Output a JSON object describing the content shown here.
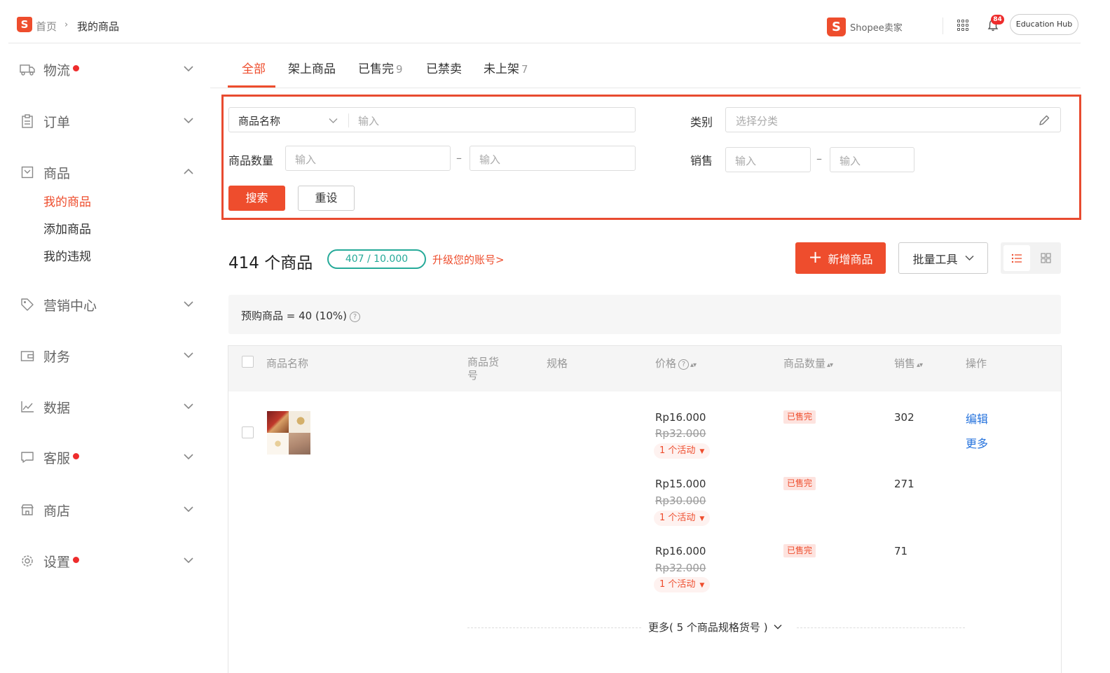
{
  "breadcrumb": {
    "home": "首页",
    "sep": "›",
    "current": "我的商品"
  },
  "header": {
    "logo_letter": "S",
    "brand_text": "Shopee卖家",
    "notification_count": "84",
    "education_hub": "Education Hub"
  },
  "sidebar": {
    "items": [
      {
        "label": "物流",
        "icon": "truck-icon",
        "dot": true
      },
      {
        "label": "订单",
        "icon": "clipboard-icon",
        "dot": false
      },
      {
        "label": "商品",
        "icon": "box-icon",
        "dot": false,
        "expanded": true
      },
      {
        "label": "营销中心",
        "icon": "tag-icon",
        "dot": false
      },
      {
        "label": "财务",
        "icon": "wallet-icon",
        "dot": false
      },
      {
        "label": "数据",
        "icon": "chart-icon",
        "dot": false
      },
      {
        "label": "客服",
        "icon": "chat-icon",
        "dot": true
      },
      {
        "label": "商店",
        "icon": "shop-icon",
        "dot": false
      },
      {
        "label": "设置",
        "icon": "gear-icon",
        "dot": true
      }
    ],
    "sub_items": [
      {
        "label": "我的商品",
        "active": true
      },
      {
        "label": "添加商品",
        "active": false
      },
      {
        "label": "我的违规",
        "active": false
      }
    ]
  },
  "tabs": [
    {
      "label": "全部",
      "count": ""
    },
    {
      "label": "架上商品",
      "count": ""
    },
    {
      "label": "已售完",
      "count": "9"
    },
    {
      "label": "已禁卖",
      "count": ""
    },
    {
      "label": "未上架",
      "count": "7"
    }
  ],
  "filters": {
    "name_select": "商品名称",
    "name_placeholder": "输入",
    "category_label": "类别",
    "category_placeholder": "选择分类",
    "stock_label": "商品数量",
    "stock_min_placeholder": "输入",
    "stock_max_placeholder": "输入",
    "sales_label": "销售",
    "sales_min_placeholder": "输入",
    "sales_max_placeholder": "输入",
    "range_sep": "–",
    "search_button": "搜索",
    "reset_button": "重设"
  },
  "summary": {
    "count_num": "414",
    "count_unit": "个商品",
    "quota": "407 / 10.000",
    "upgrade_link": "升级您的账号>",
    "add_button": "新增商品",
    "add_plus": "+",
    "bulk_button": "批量工具"
  },
  "notice": {
    "text": "预购商品 = 40 (10%)",
    "help": "?"
  },
  "table": {
    "headers": {
      "name": "商品名称",
      "sku_line1": "商品货",
      "sku_line2": "号",
      "variation": "规格",
      "price": "价格",
      "stock": "商品数量",
      "sales": "销售",
      "action": "操作"
    },
    "variations": [
      {
        "price": "Rp16.000",
        "old_price": "Rp32.000",
        "promo": "1 个活动",
        "status": "已售完",
        "sales": "302"
      },
      {
        "price": "Rp15.000",
        "old_price": "Rp30.000",
        "promo": "1 个活动",
        "status": "已售完",
        "sales": "271"
      },
      {
        "price": "Rp16.000",
        "old_price": "Rp32.000",
        "promo": "1 个活动",
        "status": "已售完",
        "sales": "71"
      }
    ],
    "actions": {
      "edit": "编辑",
      "more": "更多"
    },
    "more_variations": "更多( 5 个商品规格货号 )"
  },
  "colors": {
    "brand": "#ee4d2d",
    "teal": "#26aa99",
    "link": "#2673dd",
    "highlight_box": "#e84b30"
  }
}
